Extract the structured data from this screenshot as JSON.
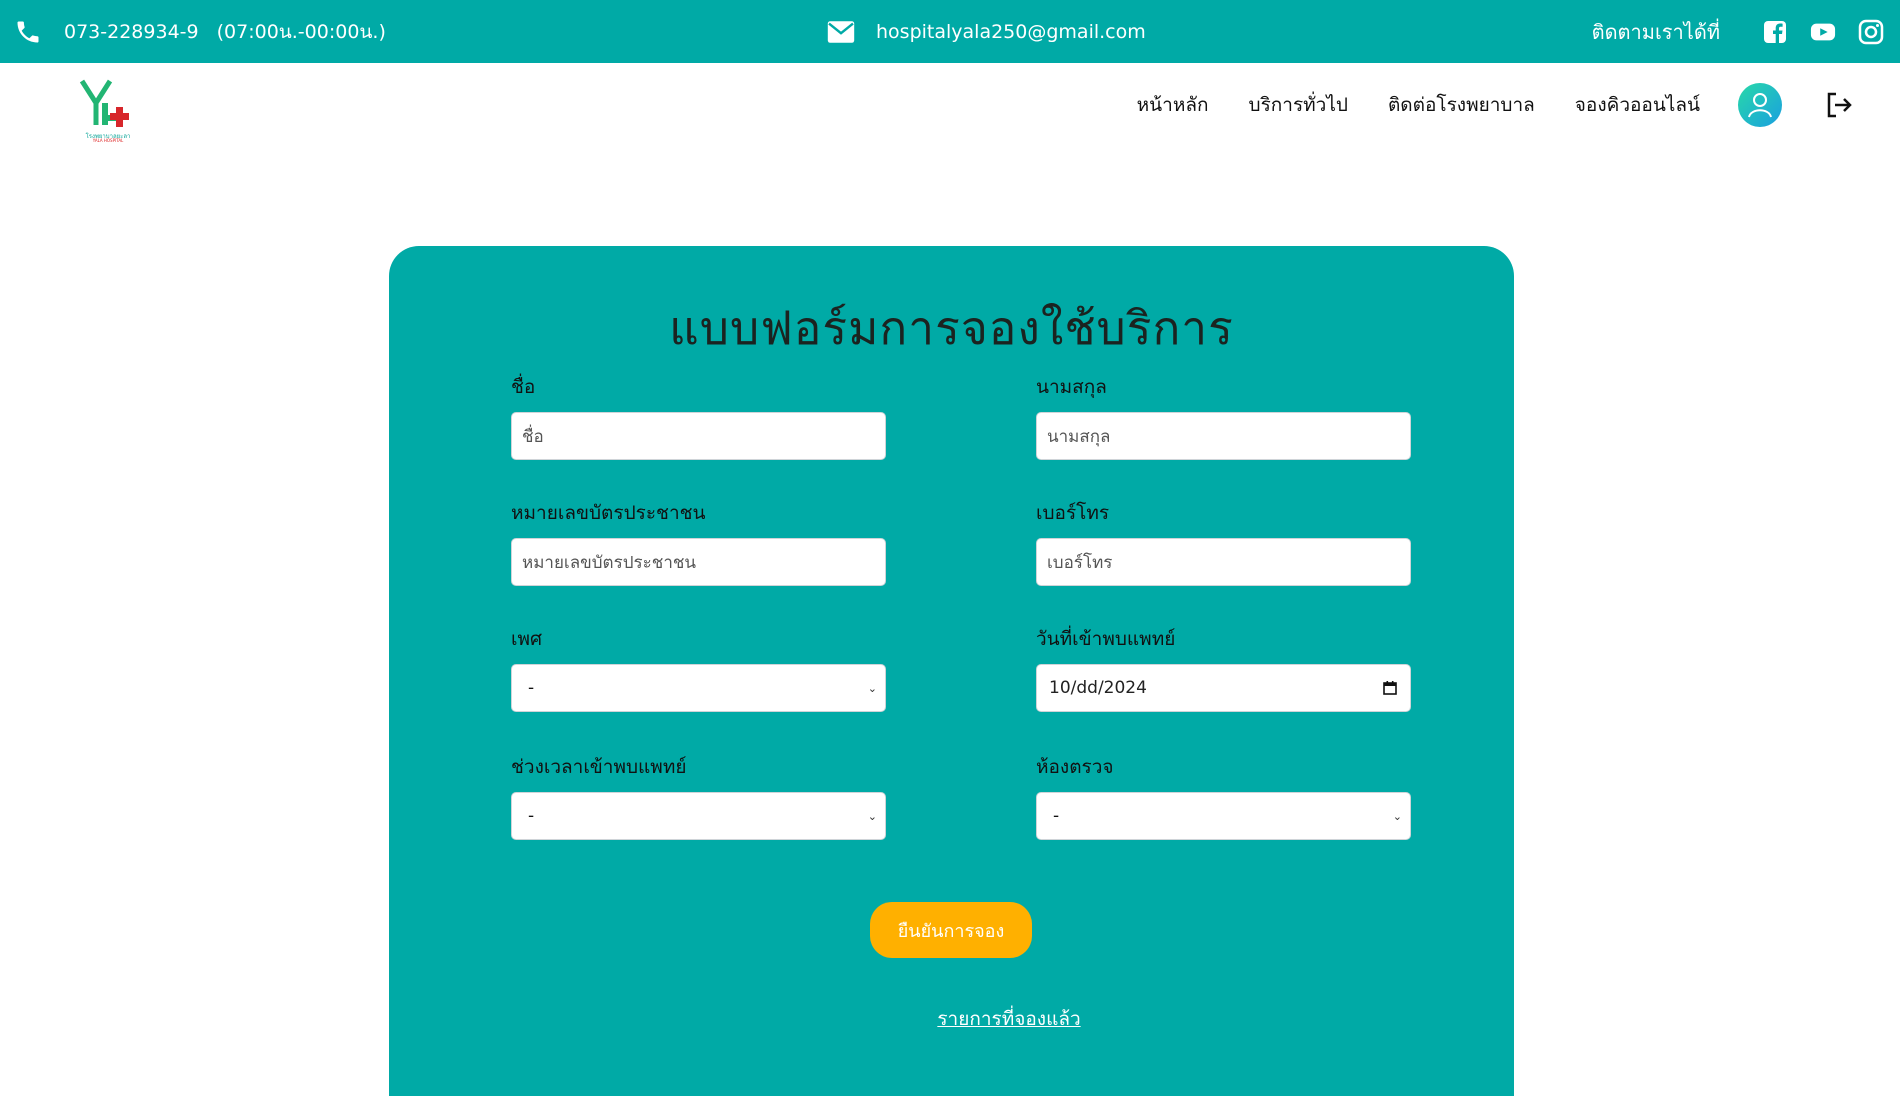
{
  "topbar": {
    "phone": "073-228934-9",
    "hours": "(07:00น.-00:00น.)",
    "email": "hospitalyala250@gmail.com",
    "follow_label": "ติดตามเราได้ที่",
    "social": [
      "facebook-icon",
      "youtube-icon",
      "instagram-icon"
    ],
    "background": "#00aaa6"
  },
  "navbar": {
    "logo_text": "โรงพยาบาลยะลา",
    "logo_sub": "YALA HOSPITAL",
    "links": [
      "หน้าหลัก",
      "บริการทั่วไป",
      "ติดต่อโรงพยาบาล",
      "จองคิวออนไลน์"
    ],
    "icons": [
      "user-avatar-icon",
      "logout-icon"
    ]
  },
  "form": {
    "title": "แบบฟอร์มการจองใช้บริการ",
    "first_name": {
      "label": "ชื่อ",
      "placeholder": "ชื่อ"
    },
    "last_name": {
      "label": "นามสกุล",
      "placeholder": "นามสกุล"
    },
    "id_card": {
      "label": "หมายเลขบัตรประชาชน",
      "placeholder": "หมายเลขบัตรประชาชน"
    },
    "phone": {
      "label": "เบอร์โทร",
      "placeholder": "เบอร์โทร"
    },
    "gender": {
      "label": "เพศ",
      "value": "-"
    },
    "visit_date": {
      "label": "วันที่เข้าพบแพทย์",
      "value": "10/dd/2024"
    },
    "time_slot": {
      "label": "ช่วงเวลาเข้าพบแพทย์",
      "value": "-"
    },
    "room": {
      "label": "ห้องตรวจ",
      "value": "-"
    },
    "submit_label": "ยืนยันการจอง",
    "booked_link": "รายการที่จองแล้ว",
    "card_color": "#00aaa6",
    "button_color": "#ffb000"
  }
}
